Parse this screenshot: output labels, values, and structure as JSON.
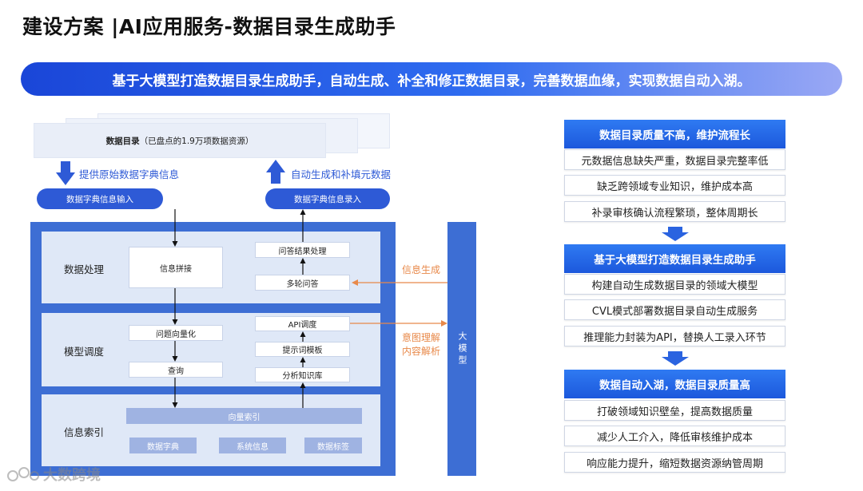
{
  "title": "建设方案 |AI应用服务-数据目录生成助手",
  "banner": "基于大模型打造数据目录生成助手，自动生成、补全和修正数据目录，完善数据血缘，实现数据自动入湖。",
  "diagram": {
    "catalog_bold": "数据目录",
    "catalog_note": "（已盘点的1.9万项数据资源）",
    "left_arrow_label": "提供原始数据字典信息",
    "right_arrow_label": "自动生成和补填元数据",
    "input_pill": "数据字典信息输入",
    "output_pill": "数据字典信息录入",
    "bands": {
      "processing": "数据处理",
      "scheduling": "模型调度",
      "indexing": "信息索引"
    },
    "boxes": {
      "info_splice": "信息拼接",
      "qa_result": "问答结果处理",
      "multi_turn": "多轮问答",
      "question_vector": "问题向量化",
      "query": "查询",
      "api_call": "API调度",
      "prompt_template": "提示词模板",
      "analyze_kb": "分析知识库",
      "vector_index": "向量索引",
      "data_dict": "数据字典",
      "system_info": "系统信息",
      "data_tag": "数据标签"
    },
    "llm": "大模型",
    "info_gen": "信息生成",
    "intent_line1": "意图理解",
    "intent_line2": "内容解析"
  },
  "right_panel": {
    "groups": [
      {
        "heading": "数据目录质量不高，维护流程长",
        "items": [
          "元数据信息缺失严重，数据目录完整率低",
          "缺乏跨领域专业知识，维护成本高",
          "补录审核确认流程繁琐，整体周期长"
        ]
      },
      {
        "heading": "基于大模型打造数据目录生成助手",
        "items": [
          "构建自动生成数据目录的领域大模型",
          "CVL模式部署数据目录自动生成服务",
          "推理能力封装为API，替换人工录入环节"
        ]
      },
      {
        "heading": "数据自动入湖，数据目录质量高",
        "items": [
          "打破领域知识壁垒，提高数据质量",
          "减少人工介入，降低审核维护成本",
          "响应能力提升，缩短数据资源纳管周期"
        ]
      }
    ]
  },
  "watermark": "大数跨境",
  "colors": {
    "primary": "#2e5ad6",
    "framework": "#3d6ed4",
    "band": "#dfe8f7",
    "orange": "#e8894a"
  }
}
